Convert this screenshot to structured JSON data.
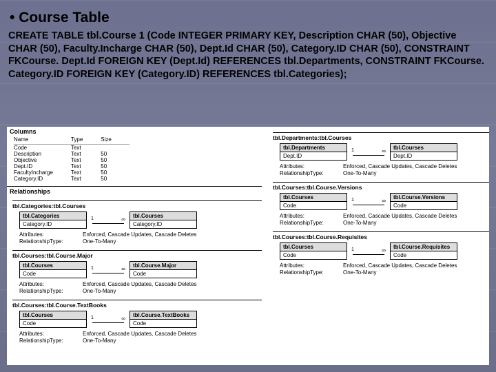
{
  "header": {
    "title": "Course Table"
  },
  "sql": "CREATE TABLE tbl.Course 1 (Code  INTEGER PRIMARY KEY, Description CHAR (50), Objective CHAR (50), Faculty.Incharge CHAR (50), Dept.Id CHAR (50), Category.ID CHAR (50),  CONSTRAINT FKCourse. Dept.Id FOREIGN KEY (Dept.Id) REFERENCES tbl.Departments, CONSTRAINT FKCourse. Category.ID FOREIGN KEY (Category.ID) REFERENCES tbl.Categories);",
  "columnsSection": {
    "heading": "Columns",
    "headers": [
      "Name",
      "Type",
      "Size"
    ],
    "rows": [
      [
        "Code",
        "Text",
        ""
      ],
      [
        "Description",
        "Text",
        "50"
      ],
      [
        "Objective",
        "Text",
        "50"
      ],
      [
        "Dept.ID",
        "Text",
        "50"
      ],
      [
        "FacultyIncharge",
        "Text",
        "50"
      ],
      [
        "Category.ID",
        "Text",
        "50"
      ]
    ]
  },
  "relationshipsHeading": "Relationships",
  "relsLeft": [
    {
      "name": "tbl.Categories:tbl.Courses",
      "left": {
        "title": "tbl.Categories",
        "field": "Category.ID"
      },
      "right": {
        "title": "tbl.Courses",
        "field": "Category.ID"
      },
      "attrs": "Enforced, Cascade Updates, Cascade Deletes",
      "reltype": "One-To-Many"
    },
    {
      "name": "tbl.Courses:tbl.Course.Major",
      "left": {
        "title": "tbl.Courses",
        "field": "Code"
      },
      "right": {
        "title": "tbl.Course.Major",
        "field": "Code"
      },
      "attrs": "Enforced, Cascade Updates, Cascade Deletes",
      "reltype": "One-To-Many"
    },
    {
      "name": "tbl.Courses:tbl.Course.TextBooks",
      "left": {
        "title": "tbl.Courses",
        "field": "Code"
      },
      "right": {
        "title": "tbl.Course.TextBooks",
        "field": "Code"
      },
      "attrs": "Enforced, Cascade Updates, Cascade Deletes",
      "reltype": "One-To-Many"
    }
  ],
  "relsRight": [
    {
      "name": "tbl.Departments:tbl.Courses",
      "left": {
        "title": "tbl.Departments",
        "field": "Dept.ID"
      },
      "right": {
        "title": "tbl.Courses",
        "field": "Dept.ID"
      },
      "attrs": "Enforced, Cascade Updates, Cascade Deletes",
      "reltype": "One-To-Many"
    },
    {
      "name": "tbl.Courses:tbl.Course.Versions",
      "left": {
        "title": "tbl.Courses",
        "field": "Code"
      },
      "right": {
        "title": "tbl.Course.Versions",
        "field": "Code"
      },
      "attrs": "Enforced, Cascade Updates, Cascade Deletes",
      "reltype": "One-To-Many"
    },
    {
      "name": "tbl.Courses:tbl.Course.Requisites",
      "left": {
        "title": "tbl.Courses",
        "field": "Code"
      },
      "right": {
        "title": "tbl.Course.Requisites",
        "field": "Code"
      },
      "attrs": "Enforced, Cascade Updates, Cascade Deletes",
      "reltype": "One-To-Many"
    }
  ],
  "labels": {
    "attributes": "Attributes:",
    "relationshipType": "RelationshipType:"
  }
}
